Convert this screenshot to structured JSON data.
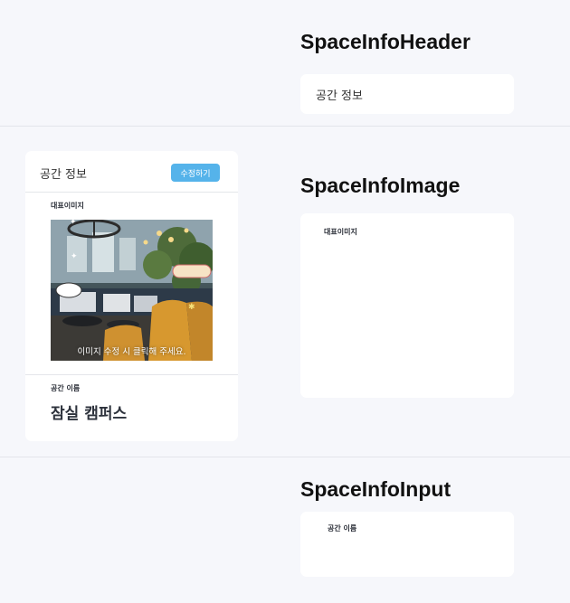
{
  "sections": {
    "header_title": "SpaceInfoHeader",
    "image_title": "SpaceInfoImage",
    "input_title": "SpaceInfoInput"
  },
  "header_card": {
    "label": "공간 정보"
  },
  "image_card": {
    "label": "대표이미지"
  },
  "input_card": {
    "label": "공간 이름"
  },
  "preview": {
    "title": "공간 정보",
    "edit_button": "수정하기",
    "image_label": "대표이미지",
    "image_hint": "이미지 수정 시 클릭해 주세요.",
    "name_label": "공간 이름",
    "name_value": "잠실 캠퍼스"
  },
  "colors": {
    "background": "#f6f7fb",
    "card": "#ffffff",
    "accent_button": "#55b3ea"
  }
}
